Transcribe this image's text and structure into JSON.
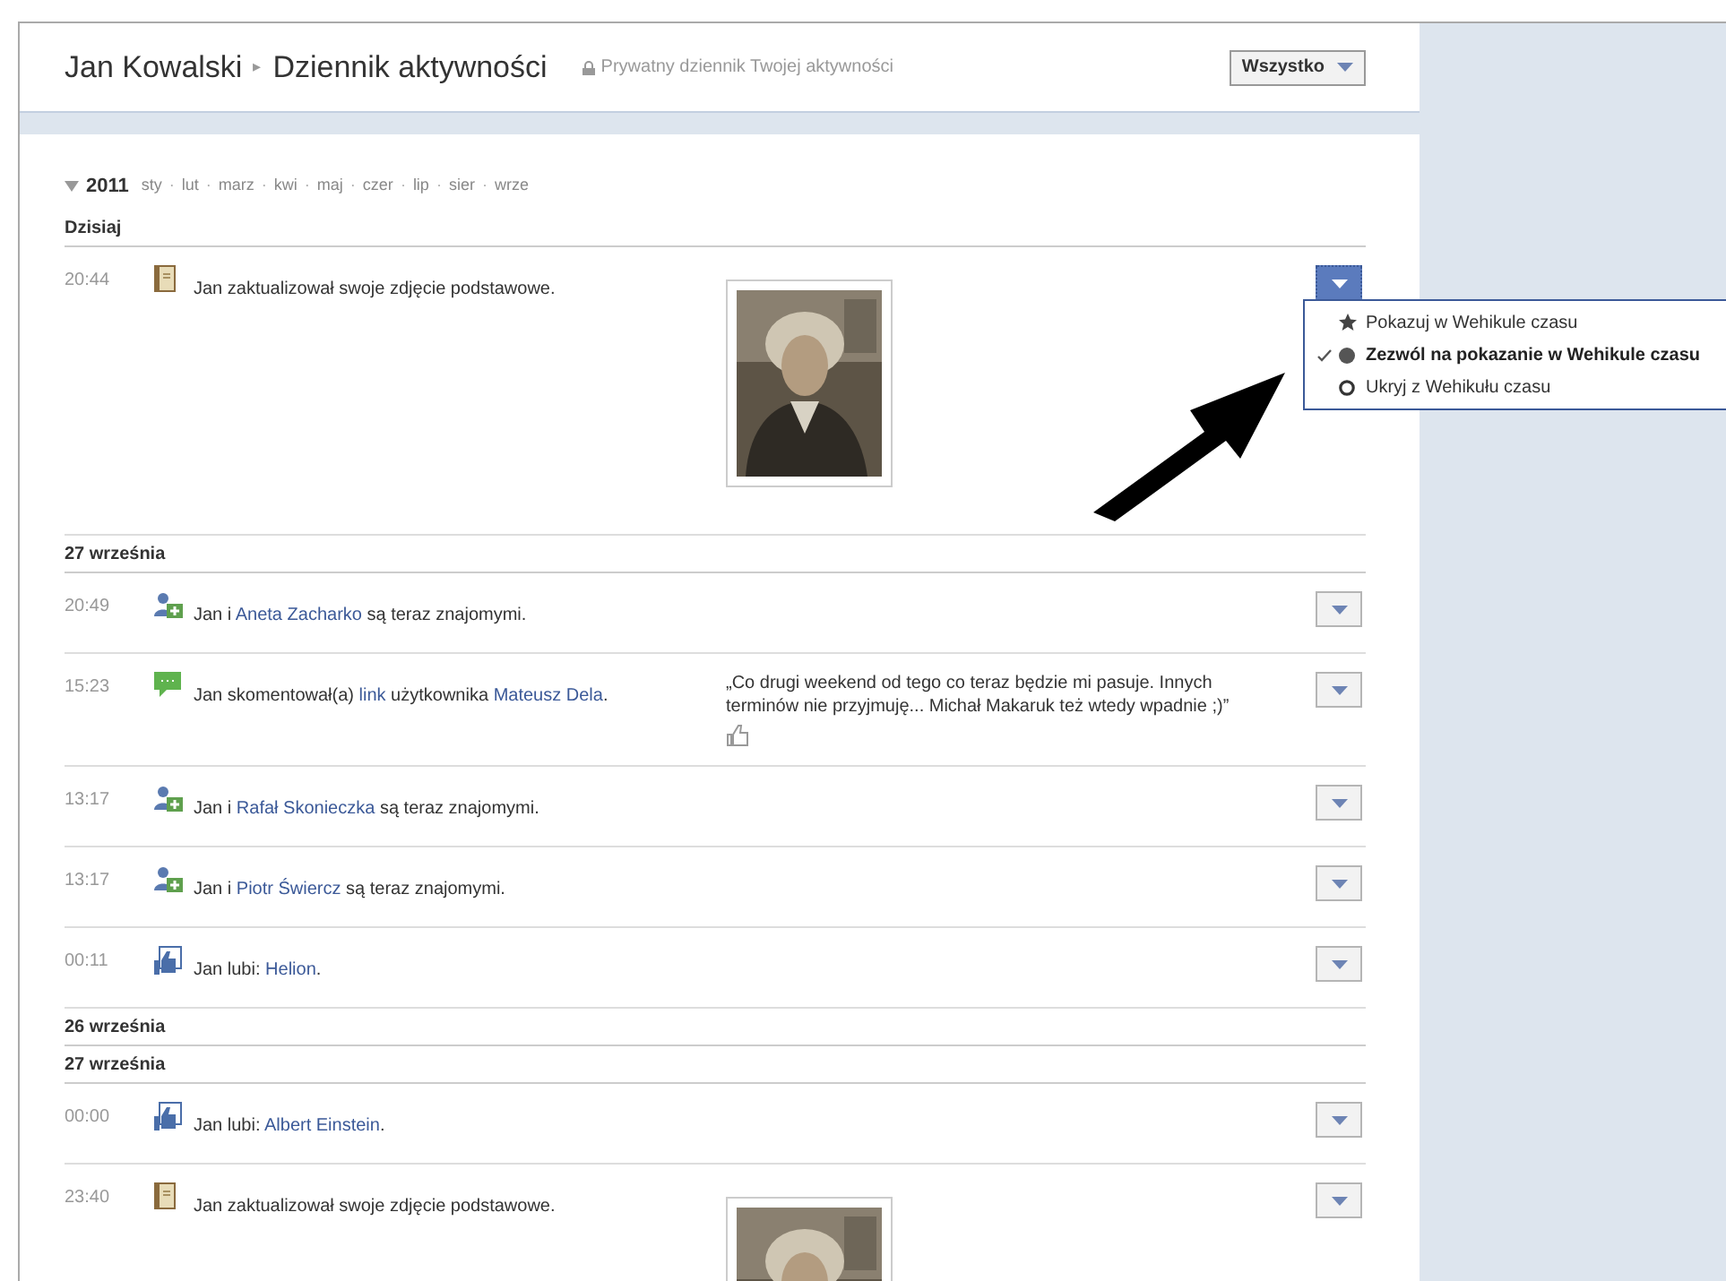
{
  "header": {
    "name": "Jan Kowalski",
    "separator": "▸",
    "title": "Dziennik aktywności",
    "privacy_note": "Prywatny dziennik Twojej aktywności",
    "filter_button": "Wszystko"
  },
  "timeline": {
    "expanded": true,
    "year": "2011",
    "months": [
      "sty",
      "lut",
      "marz",
      "kwi",
      "maj",
      "czer",
      "lip",
      "sier",
      "wrze"
    ],
    "month_separator": "·"
  },
  "entries": [
    {
      "kind": "date",
      "label": "Dzisiaj"
    },
    {
      "kind": "photo_update",
      "time": "20:44",
      "parts": [
        {
          "kind": "text",
          "text": "Jan zaktualizował swoje zdjęcie podstawowe."
        }
      ],
      "menu_open": true
    },
    {
      "kind": "date",
      "label": "27 września"
    },
    {
      "kind": "friendship",
      "time": "20:49",
      "parts": [
        {
          "kind": "text",
          "text": "Jan i "
        },
        {
          "kind": "link",
          "text": "Aneta Zacharko"
        },
        {
          "kind": "text",
          "text": " są teraz znajomymi."
        }
      ],
      "menu_open": false
    },
    {
      "kind": "comment",
      "time": "15:23",
      "parts": [
        {
          "kind": "text",
          "text": "Jan skomentował(a) "
        },
        {
          "kind": "link",
          "text": "link"
        },
        {
          "kind": "text",
          "text": " użytkownika "
        },
        {
          "kind": "link",
          "text": "Mateusz Dela"
        },
        {
          "kind": "text",
          "text": "."
        }
      ],
      "quote": "„Co drugi weekend od tego co teraz będzie mi pasuje. Innych terminów nie przyjmuję... Michał Makaruk też wtedy wpadnie ;)”",
      "menu_open": false
    },
    {
      "kind": "friendship",
      "time": "13:17",
      "parts": [
        {
          "kind": "text",
          "text": "Jan i "
        },
        {
          "kind": "link",
          "text": "Rafał Skonieczka"
        },
        {
          "kind": "text",
          "text": " są teraz znajomymi."
        }
      ],
      "menu_open": false
    },
    {
      "kind": "friendship",
      "time": "13:17",
      "parts": [
        {
          "kind": "text",
          "text": "Jan i "
        },
        {
          "kind": "link",
          "text": "Piotr Świercz"
        },
        {
          "kind": "text",
          "text": " są teraz znajomymi."
        }
      ],
      "menu_open": false
    },
    {
      "kind": "like",
      "time": "00:11",
      "parts": [
        {
          "kind": "text",
          "text": "Jan lubi: "
        },
        {
          "kind": "link",
          "text": "Helion"
        },
        {
          "kind": "text",
          "text": "."
        }
      ],
      "menu_open": false
    },
    {
      "kind": "date",
      "label": "26 września"
    },
    {
      "kind": "date",
      "label": "27 września"
    },
    {
      "kind": "like",
      "time": "00:00",
      "parts": [
        {
          "kind": "text",
          "text": "Jan lubi: "
        },
        {
          "kind": "link",
          "text": "Albert Einstein"
        },
        {
          "kind": "text",
          "text": "."
        }
      ],
      "menu_open": false
    },
    {
      "kind": "photo_update",
      "time": "23:40",
      "parts": [
        {
          "kind": "text",
          "text": "Jan zaktualizował swoje zdjęcie podstawowe."
        }
      ],
      "menu_open": false
    }
  ],
  "menu": [
    {
      "kind": "star",
      "label": "Pokazuj w Wehikule czasu",
      "selected": false
    },
    {
      "kind": "dot",
      "label": "Zezwól na pokazanie w Wehikule czasu",
      "selected": true
    },
    {
      "kind": "circle",
      "label": "Ukryj z Wehikułu czasu",
      "selected": false
    }
  ]
}
